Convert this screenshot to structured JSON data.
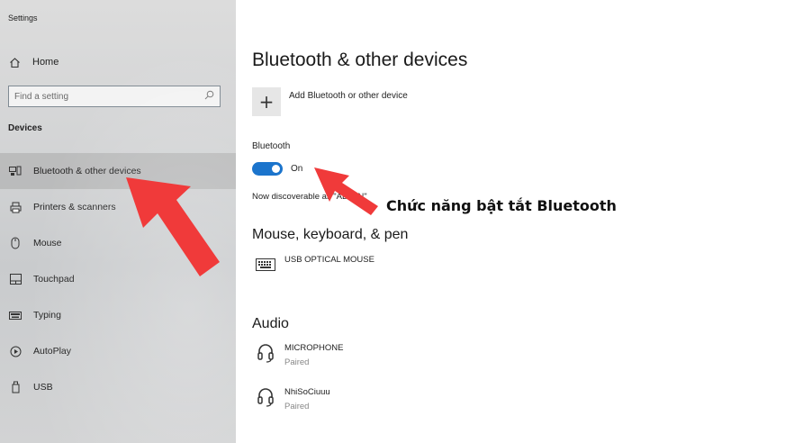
{
  "window": {
    "title": "Settings"
  },
  "sidebar": {
    "home_label": "Home",
    "search_placeholder": "Find a setting",
    "section_label": "Devices",
    "items": [
      {
        "label": "Bluetooth & other devices",
        "icon": "bluetooth-devices-icon",
        "selected": true
      },
      {
        "label": "Printers & scanners",
        "icon": "printer-icon",
        "selected": false
      },
      {
        "label": "Mouse",
        "icon": "mouse-icon",
        "selected": false
      },
      {
        "label": "Touchpad",
        "icon": "touchpad-icon",
        "selected": false
      },
      {
        "label": "Typing",
        "icon": "keyboard-icon",
        "selected": false
      },
      {
        "label": "AutoPlay",
        "icon": "autoplay-icon",
        "selected": false
      },
      {
        "label": "USB",
        "icon": "usb-icon",
        "selected": false
      }
    ]
  },
  "main": {
    "title": "Bluetooth & other devices",
    "add_device_symbol": "+",
    "add_device_label": "Add Bluetooth or other device",
    "bluetooth_label": "Bluetooth",
    "bluetooth_state": "On",
    "discoverable_text": "Now discoverable as \"ADMIN\"",
    "sections": {
      "mkp_title": "Mouse, keyboard, & pen",
      "audio_title": "Audio"
    },
    "devices": {
      "mouse": {
        "name": "USB OPTICAL MOUSE"
      },
      "microphone": {
        "name": "MICROPHONE",
        "status": "Paired"
      },
      "nhisociuuu": {
        "name": "NhiSoCiuuu",
        "status": "Paired"
      }
    }
  },
  "annotation": {
    "text": "Chức năng bật tắt Bluetooth",
    "arrow_color": "#f03a3a"
  },
  "colors": {
    "accent": "#1b74cc",
    "toggle_knob": "#ffffff",
    "arrow": "#f03a3a"
  }
}
